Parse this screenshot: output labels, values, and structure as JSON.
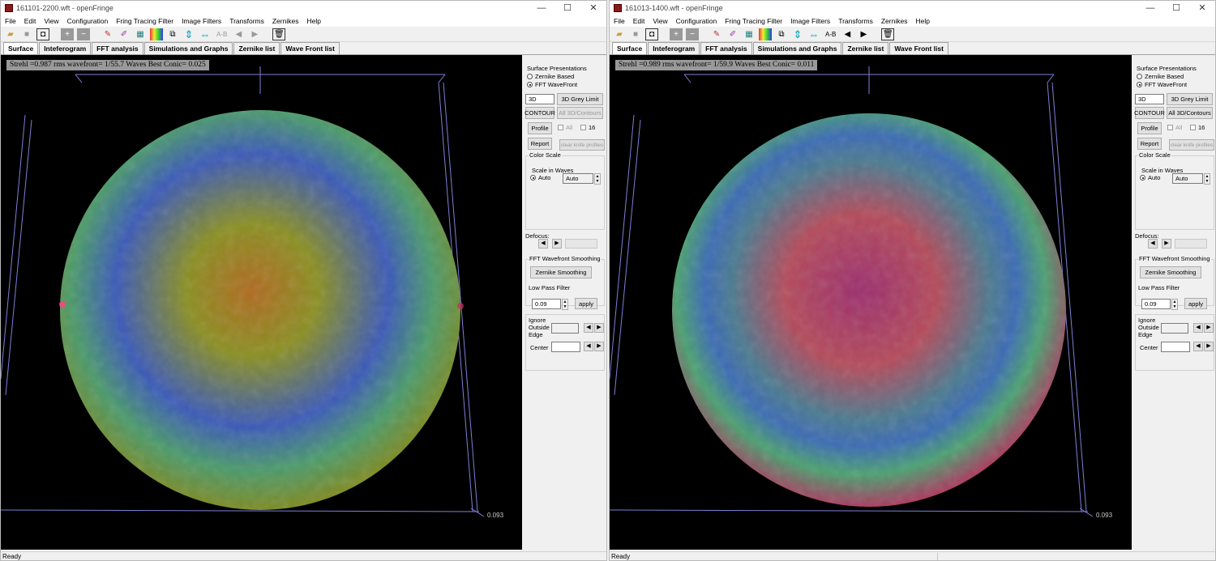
{
  "left": {
    "title": "161101-2200.wft - openFringe",
    "strehl": "Strehl =0.987 rms wavefront= 1/55.7 Waves Best Conic= 0.025",
    "gradient": {
      "center": "#b06a1e",
      "mid": "#8a8f22",
      "ring": "#3a59b8",
      "edge": "#4a9a6a",
      "outer": "#7c8a22"
    }
  },
  "right": {
    "title": "161013-1400.wft - openFringe",
    "strehl": "Strehl =0.989 rms wavefront= 1/59.9 Waves Best Conic= 0.011",
    "gradient": {
      "center": "#9c2e6e",
      "mid": "#b44a5a",
      "ring": "#3a6ab4",
      "edge": "#4aa070",
      "outer": "#a83a5e"
    }
  },
  "window_controls": {
    "minimize": "—",
    "maximize": "☐",
    "close": "✕"
  },
  "menu": [
    "File",
    "Edit",
    "View",
    "Configuration",
    "Fring Tracing Filter",
    "Image Filters",
    "Transforms",
    "Zernikes",
    "Help"
  ],
  "toolbar": {
    "ab_label": "A-B"
  },
  "tabs": [
    "Surface",
    "Inteferogram",
    "FFT analysis",
    "Simulations and Graphs",
    "Zernike list",
    "Wave Front list"
  ],
  "panel": {
    "surface_presentations": "Surface Presentations",
    "zernike_based": "Zernike Based",
    "fft_wavefront": "FFT WaveFront",
    "btn_3d": "3D",
    "btn_3d_grey_limit": "3D Grey Limit",
    "btn_contour": "CONTOUR",
    "btn_all_3d_contours": "All 3D/Contours",
    "btn_profile": "Profile",
    "chk_all": "All",
    "chk_16": "16",
    "btn_report": "Report",
    "btn_clear_knife": "clear knife profiles",
    "color_scale": "Color Scale",
    "scale_in_waves": "Scale in Waves",
    "auto_radio": "Auto",
    "auto_field": "Auto",
    "defocus": "Defocus:",
    "fft_smoothing": "FFT Wavefront Smoothing",
    "btn_zernike_smoothing": "Zernike Smoothing",
    "low_pass_filter": "Low Pass Filter",
    "low_pass_value": "0.09",
    "btn_apply": "apply",
    "ignore": "Ignore",
    "outside": "Outside",
    "edge": "Edge",
    "center": "Center"
  },
  "scale_label": "0.093",
  "scale_label_right": "0.093",
  "status": "Ready",
  "status_right": "Ready"
}
